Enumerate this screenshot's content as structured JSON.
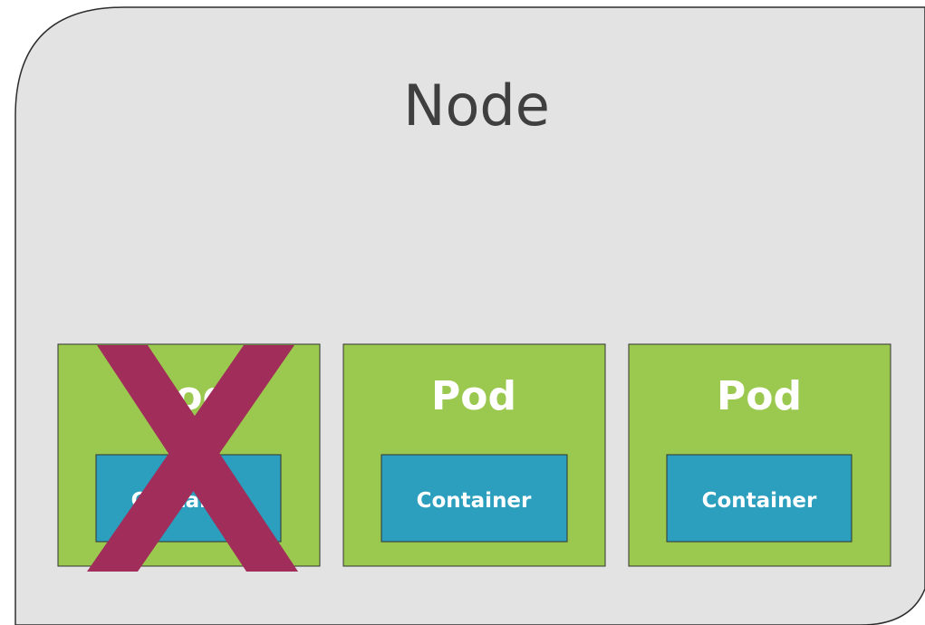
{
  "node": {
    "title": "Node"
  },
  "pods": [
    {
      "label": "Pod",
      "container_label": "Container",
      "removed": true
    },
    {
      "label": "Pod",
      "container_label": "Container",
      "removed": false
    },
    {
      "label": "Pod",
      "container_label": "Container",
      "removed": false
    }
  ],
  "colors": {
    "node_fill": "#e3e3e3",
    "pod_fill": "#9bc94f",
    "container_fill": "#2b9fbd",
    "text_light": "#ffffff",
    "text_dark": "#3f3f3f",
    "cross_mark": "#a12d5a"
  }
}
